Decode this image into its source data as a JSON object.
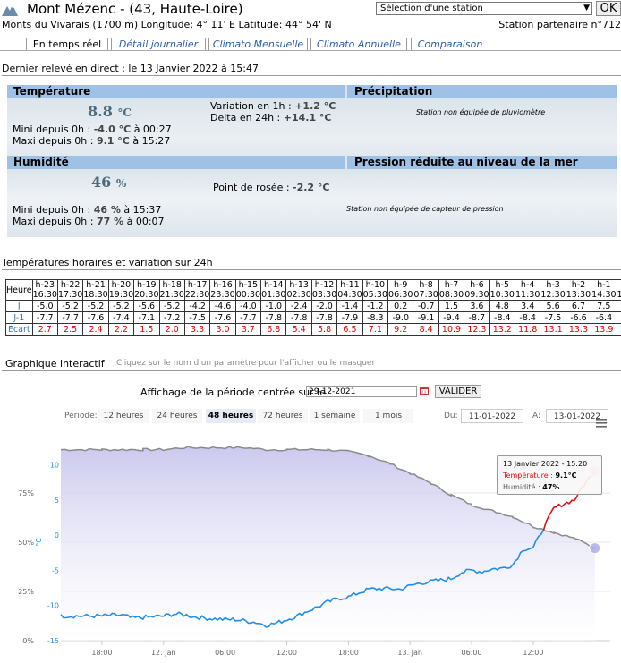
{
  "header": {
    "title": "Mont Mézenc - (43, Haute-Loire)",
    "station_select": "Sélection d'une station",
    "ok_label": "OK",
    "info_line": "Monts du Vivarais (1700 m)   Longitude: 4° 11' E   Latitude: 44° 54' N",
    "partner": "Station partenaire n°712"
  },
  "tabs": [
    {
      "label": "En temps réel",
      "active": true
    },
    {
      "label": "Détail journalier",
      "active": false
    },
    {
      "label": "Climato Mensuelle",
      "active": false
    },
    {
      "label": "Climato Annuelle",
      "active": false
    },
    {
      "label": "Comparaison",
      "active": false
    }
  ],
  "releve": {
    "heading": "Dernier relevé en direct : le 13 Janvier 2022 à 15:47"
  },
  "temperature": {
    "title": "Température",
    "value": "8.8",
    "unit": "°C",
    "mini_label": "Mini depuis 0h : ",
    "mini_value": "-4.0 °C",
    "mini_time": " à 00:27",
    "maxi_label": "Maxi depuis 0h : ",
    "maxi_value": "9.1 °C",
    "maxi_time": " à 15:27",
    "var_label": "Variation en 1h : ",
    "var_value": "+1.2 °C",
    "delta_label": "Delta en 24h : ",
    "delta_value": "+14.1 °C"
  },
  "precipitation": {
    "title": "Précipitation",
    "note": "Station non équipée de pluviomètre"
  },
  "humidity": {
    "title": "Humidité",
    "value": "46",
    "unit": "%",
    "mini_label": "Mini depuis 0h : ",
    "mini_value": "46 %",
    "mini_time": " à 15:37",
    "maxi_label": "Maxi depuis 0h : ",
    "maxi_value": "77 %",
    "maxi_time": " à 00:07",
    "dew_label": "Point de rosée : ",
    "dew_value": "-2.2 °C"
  },
  "pressure": {
    "title": "Pression réduite au niveau de la mer",
    "note": "Station non équipée de capteur de pression"
  },
  "hourly": {
    "heading": "Températures horaires et variation sur 24h",
    "labels": {
      "heure": "Heure",
      "j": "J",
      "j1": "J-1",
      "ecart": "Ecart"
    },
    "offsets": [
      "h-23",
      "h-22",
      "h-21",
      "h-20",
      "h-19",
      "h-18",
      "h-17",
      "h-16",
      "h-15",
      "h-14",
      "h-13",
      "h-12",
      "h-11",
      "h-10",
      "h-9",
      "h-8",
      "h-7",
      "h-6",
      "h-5",
      "h-4",
      "h-3",
      "h-2",
      "h-1",
      "h"
    ],
    "times": [
      "16:30",
      "17:30",
      "18:30",
      "19:30",
      "20:30",
      "21:30",
      "22:30",
      "23:30",
      "00:30",
      "01:30",
      "02:30",
      "03:30",
      "04:30",
      "05:30",
      "06:30",
      "07:30",
      "08:30",
      "09:30",
      "10:30",
      "11:30",
      "12:30",
      "13:30",
      "14:30",
      "15:30"
    ],
    "j": [
      "-5.0",
      "-5.2",
      "-5.2",
      "-5.2",
      "-5.6",
      "-5.2",
      "-4.2",
      "-4.6",
      "-4.0",
      "-1.0",
      "-2.4",
      "-2.0",
      "-1.4",
      "-1.2",
      "0.2",
      "-0.7",
      "1.5",
      "3.6",
      "4.8",
      "3.4",
      "5.6",
      "6.7",
      "7.5",
      "9.1"
    ],
    "j1": [
      "-7.7",
      "-7.7",
      "-7.6",
      "-7.4",
      "-7.1",
      "-7.2",
      "-7.5",
      "-7.6",
      "-7.7",
      "-7.8",
      "-7.8",
      "-7.8",
      "-7.9",
      "-8.3",
      "-9.0",
      "-9.1",
      "-9.4",
      "-8.7",
      "-8.4",
      "-8.4",
      "-7.5",
      "-6.6",
      "-6.4",
      "-5.7"
    ],
    "ecart": [
      "2.7",
      "2.5",
      "2.4",
      "2.2",
      "1.5",
      "2.0",
      "3.3",
      "3.0",
      "3.7",
      "6.8",
      "5.4",
      "5.8",
      "6.5",
      "7.1",
      "9.2",
      "8.4",
      "10.9",
      "12.3",
      "13.2",
      "11.8",
      "13.1",
      "13.3",
      "13.9",
      "14.8"
    ]
  },
  "graph": {
    "title": "Graphique interactif",
    "hint": "Cliquez sur le nom d'un paramètre pour l'afficher ou le masquer",
    "period_label": "Affichage de la période centrée sur le",
    "period_value": "29-12-2021",
    "valider": "VALIDER",
    "periode": "Période:",
    "ranges": [
      {
        "label": "12 heures",
        "active": false
      },
      {
        "label": "24 heures",
        "active": false
      },
      {
        "label": "48 heures",
        "active": true
      },
      {
        "label": "72 heures",
        "active": false
      },
      {
        "label": "1 semaine",
        "active": false
      },
      {
        "label": "1 mois",
        "active": false
      }
    ],
    "du_label": "Du:",
    "du_value": "11-01-2022",
    "a_label": "A:",
    "a_value": "13-01-2022",
    "tooltip": {
      "date": "13 Janvier 2022 - 15:20",
      "temp_label": "Température : ",
      "temp_value": "9.1°C",
      "hum_label": "Humidité : ",
      "hum_value": "47%"
    },
    "colors": {
      "temp_blue": "#1f8fe6",
      "temp_red": "#e01010",
      "humidity": "#8a8a8a",
      "humidity_fill": "#c9c6ee"
    }
  },
  "chart_data": {
    "type": "line",
    "title": "",
    "xlabel": "",
    "y_left_label": "",
    "y_right_label": "°C",
    "x_ticks": [
      "18:00",
      "12. Jan",
      "06:00",
      "12:00",
      "18:00",
      "13. Jan",
      "06:00",
      "12:00"
    ],
    "y_left_ticks": [
      "0%",
      "25%",
      "50%",
      "75%"
    ],
    "y_right_ticks": [
      "-15",
      "-10",
      "-5",
      "0",
      "5",
      "10"
    ],
    "humidity_ylim": [
      0,
      100
    ],
    "temperature_ylim": [
      -15,
      13
    ],
    "series": [
      {
        "name": "Température",
        "axis": "°C",
        "x_hours": [
          0,
          1,
          2,
          3,
          4,
          5,
          6,
          7,
          8,
          9,
          10,
          11,
          12,
          13,
          14,
          15,
          16,
          17,
          18,
          19,
          20,
          21,
          22,
          23,
          24,
          25,
          26,
          27,
          28,
          29,
          30,
          31,
          32,
          33,
          34,
          35,
          36,
          37,
          38,
          39,
          40,
          41,
          42,
          43,
          44,
          45,
          46,
          47,
          48
        ],
        "values": [
          -11.5,
          -11.4,
          -11.4,
          -11.8,
          -11.7,
          -11.6,
          -11.5,
          -11.2,
          -11.3,
          -11.6,
          -11.8,
          -11.9,
          -12.0,
          -12.0,
          -12.2,
          -12.4,
          -12.8,
          -12.5,
          -12.0,
          -11.5,
          -10.8,
          -10.2,
          -9.5,
          -9.0,
          -8.8,
          -8.2,
          -7.7,
          -7.6,
          -7.6,
          -7.7,
          -7.2,
          -6.8,
          -6.6,
          -6.4,
          -6.2,
          -5.3,
          -5.0,
          -5.2,
          -4.8,
          -4.7,
          -4.2,
          -2.0,
          -1.8,
          1.0,
          3.8,
          4.5,
          5.0,
          7.3,
          9.1
        ]
      },
      {
        "name": "Humidité",
        "axis": "%",
        "x_hours": [
          0,
          2,
          4,
          6,
          8,
          10,
          12,
          14,
          16,
          18,
          20,
          22,
          24,
          26,
          28,
          30,
          32,
          34,
          36,
          38,
          40,
          42,
          44,
          46,
          48
        ],
        "values": [
          97,
          97,
          97,
          97,
          98,
          98,
          98,
          98,
          97,
          97,
          97,
          97,
          96,
          94,
          90,
          85,
          80,
          74,
          69,
          66,
          63,
          58,
          55,
          52,
          47
        ]
      }
    ]
  }
}
